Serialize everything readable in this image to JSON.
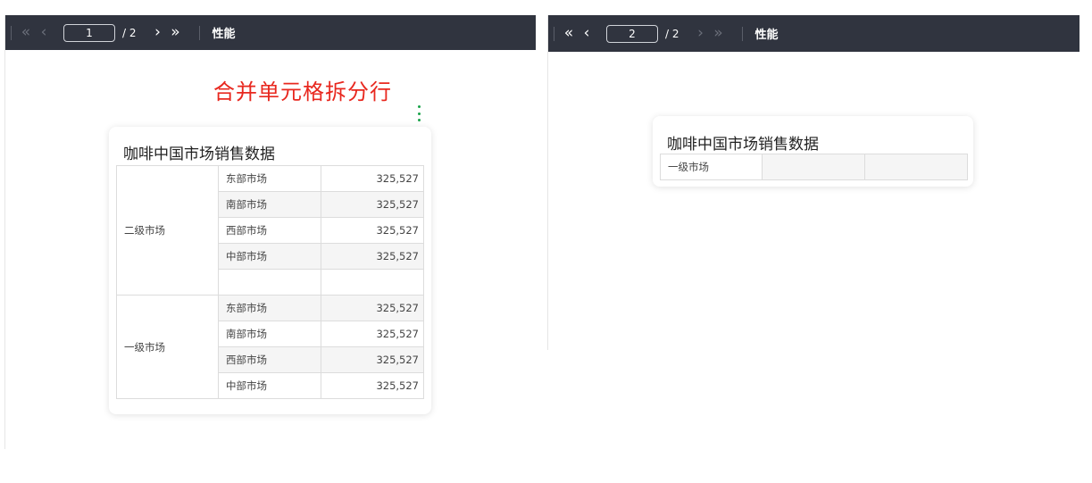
{
  "panels": [
    {
      "toolbar": {
        "current_page": "1",
        "total": "/ 2",
        "perf_label": "性能",
        "icons": [
          "first-page-icon",
          "prev-page-icon",
          "next-page-icon",
          "last-page-icon"
        ]
      },
      "heading": "合并单元格拆分行",
      "card_title": "咖啡中国市场销售数据",
      "groups": [
        {
          "name": "二级市场",
          "rows": [
            {
              "market": "东部市场",
              "value": "325,527"
            },
            {
              "market": "南部市场",
              "value": "325,527"
            },
            {
              "market": "西部市场",
              "value": "325,527"
            },
            {
              "market": "中部市场",
              "value": "325,527"
            },
            {
              "market": "",
              "value": ""
            }
          ]
        },
        {
          "name": "一级市场",
          "rows": [
            {
              "market": "东部市场",
              "value": "325,527"
            },
            {
              "market": "南部市场",
              "value": "325,527"
            },
            {
              "market": "西部市场",
              "value": "325,527"
            },
            {
              "market": "中部市场",
              "value": "325,527"
            }
          ]
        }
      ]
    },
    {
      "toolbar": {
        "current_page": "2",
        "total": "/ 2",
        "perf_label": "性能"
      },
      "card_title": "咖啡中国市场销售数据",
      "rows": [
        {
          "col1": "一级市场",
          "col2": "",
          "col3": ""
        }
      ]
    }
  ],
  "colors": {
    "toolbar_bg": "#30343f",
    "heading_red": "#e8281f",
    "menu_green": "#1aa34a"
  }
}
